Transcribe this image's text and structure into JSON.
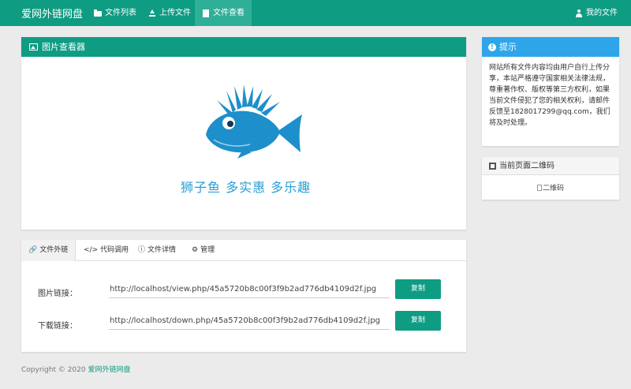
{
  "navbar": {
    "brand": "爱网外链网盘",
    "items": [
      {
        "label": "文件列表",
        "icon": "folder-icon"
      },
      {
        "label": "上传文件",
        "icon": "upload-icon"
      },
      {
        "label": "文件查看",
        "icon": "file-icon"
      }
    ],
    "active_index": 2,
    "user_label": "我的文件"
  },
  "viewer": {
    "title": "图片查看器",
    "slogan": "狮子鱼  多实惠  多乐趣"
  },
  "tip": {
    "title": "提示",
    "body": "网站所有文件内容均由用户自行上传分享，本站严格遵守国家相关法律法规，尊重著作权、版权等第三方权利，如果当前文件侵犯了您的相关权利，请邮件反馈至1828017299@qq.com，我们将及时处理。"
  },
  "qr": {
    "title": "当前页面二维码",
    "alt": "二维码"
  },
  "links": {
    "tabs": [
      {
        "label": "文件外链",
        "icon": "link-icon"
      },
      {
        "label": "代码调用",
        "icon": "code-icon"
      },
      {
        "label": "文件详情",
        "icon": "info-icon"
      },
      {
        "label": "管理",
        "icon": "gear-icon"
      }
    ],
    "active_tab": 0,
    "image_label": "图片链接：",
    "image_url": "http://localhost/view.php/45a5720b8c00f3f9b2ad776db4109d2f.jpg",
    "download_label": "下载链接：",
    "download_url": "http://localhost/down.php/45a5720b8c00f3f9b2ad776db4109d2f.jpg",
    "copy_label": "复制"
  },
  "footer": {
    "copyright": "Copyright © 2020",
    "site_name": "爱网外链网盘"
  },
  "colors": {
    "primary": "#0e9c83",
    "info": "#2ea5e8",
    "fish": "#1d8fcb"
  }
}
